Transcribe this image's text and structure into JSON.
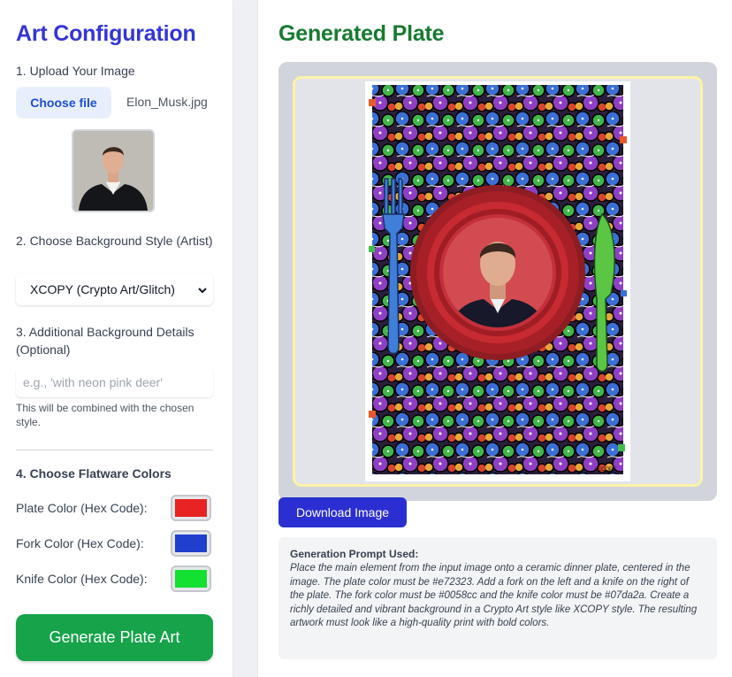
{
  "config": {
    "title": "Art Configuration",
    "step1_label": "1. Upload Your Image",
    "choose_file_label": "Choose file",
    "file_name": "Elon_Musk.jpg",
    "step2_label": "2. Choose Background Style (Artist)",
    "style_selected": "XCOPY (Crypto Art/Glitch)",
    "step3_label": "3. Additional Background Details (Optional)",
    "details_placeholder": "e.g., 'with neon pink deer'",
    "details_hint": "This will be combined with the chosen style.",
    "step4_label": "4. Choose Flatware Colors",
    "plate_label": "Plate Color (Hex Code):",
    "fork_label": "Fork Color (Hex Code):",
    "knife_label": "Knife Color (Hex Code):",
    "plate_color": "#e72323",
    "fork_color": "#1f3fcc",
    "knife_color": "#14e032",
    "generate_label": "Generate Plate Art",
    "title_color": "#3535d6",
    "generate_color": "#16a34a"
  },
  "result": {
    "title": "Generated Plate",
    "title_color": "#177a31",
    "download_label": "Download Image",
    "prompt_title": "Generation Prompt Used:",
    "prompt_text": "Place the main element from the input image onto a ceramic dinner plate, centered in the image. The plate color must be #e72323. Add a fork on the left and a knife on the right of the plate. The fork color must be #0058cc and the knife color must be #07da2a. Create a richly detailed and vibrant background in a Crypto Art style like XCOPY style. The resulting artwork must look like a high-quality print with bold colors.",
    "artwork_alt": "Generated plate artwork",
    "artwork_signature": "#ECOPY"
  }
}
